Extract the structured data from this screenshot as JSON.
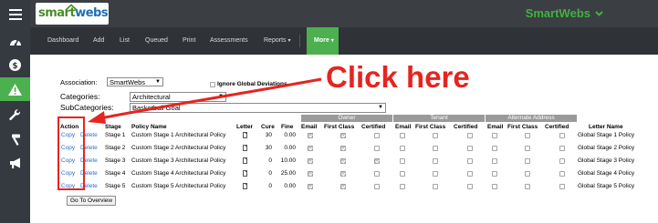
{
  "sidebar": {
    "items": [
      {
        "icon": "menu-icon"
      },
      {
        "icon": "dashboard-gauge-icon"
      },
      {
        "icon": "dollar-icon"
      },
      {
        "icon": "warning-icon",
        "active": true
      },
      {
        "icon": "wrench-icon"
      },
      {
        "icon": "hammer-icon"
      },
      {
        "icon": "megaphone-icon"
      }
    ]
  },
  "header": {
    "logo": {
      "part1": "smart",
      "part2": "webs"
    },
    "brand": "SmartWebs"
  },
  "nav": {
    "items": [
      {
        "label": "Dashboard"
      },
      {
        "label": "Add"
      },
      {
        "label": "List"
      },
      {
        "label": "Queued"
      },
      {
        "label": "Print"
      },
      {
        "label": "Assessments"
      },
      {
        "label": "Reports"
      },
      {
        "label": "More"
      }
    ]
  },
  "form": {
    "association_label": "Association:",
    "association_value": "SmartWebs",
    "ignore_label": "Ignore Global Deviations",
    "categories_label": "Categories:",
    "categories_value": "Architectural",
    "subcategories_label": "SubCategories:",
    "subcategories_value": "Basketball Goal"
  },
  "table": {
    "groups": {
      "owner": "Owner",
      "tenant": "Tenant",
      "alternate": "Alternate Address"
    },
    "headers": {
      "action": "Action",
      "stage": "Stage",
      "policy_name": "Policy Name",
      "letter": "Letter",
      "cure": "Cure",
      "fine": "Fine",
      "email": "Email",
      "first_class": "First Class",
      "certified": "Certified",
      "letter_name": "Letter Name"
    },
    "copy_label": "Copy",
    "delete_label": "Delete",
    "rows": [
      {
        "stage": "Stage 1",
        "policy": "Custom Stage 1 Architectural Policy",
        "cure": "30",
        "fine": "0.00",
        "certified": false,
        "letter_name": "Global Stage 1 Policy"
      },
      {
        "stage": "Stage 2",
        "policy": "Custom Stage 2 Architectural Policy",
        "cure": "30",
        "fine": "0.00",
        "certified": false,
        "letter_name": "Global Stage 2 Policy"
      },
      {
        "stage": "Stage 3",
        "policy": "Custom Stage 3 Architectural Policy",
        "cure": "0",
        "fine": "10.00",
        "certified": true,
        "letter_name": "Global Stage 3 Policy"
      },
      {
        "stage": "Stage 4",
        "policy": "Custom Stage 4 Architectural Policy",
        "cure": "0",
        "fine": "25.00",
        "certified": false,
        "letter_name": "Global Stage 4 Policy"
      },
      {
        "stage": "Stage 5",
        "policy": "Custom Stage 5 Architectural Policy",
        "cure": "0",
        "fine": "0.00",
        "certified": false,
        "letter_name": "Global Stage 5 Policy"
      }
    ]
  },
  "overview_button": "Go To Overview",
  "annotation": {
    "text": "Click here",
    "color": "#e52520"
  },
  "colors": {
    "accent_green": "#4caf50",
    "link_blue": "#2b70c9",
    "rail_bg": "#343a40"
  }
}
